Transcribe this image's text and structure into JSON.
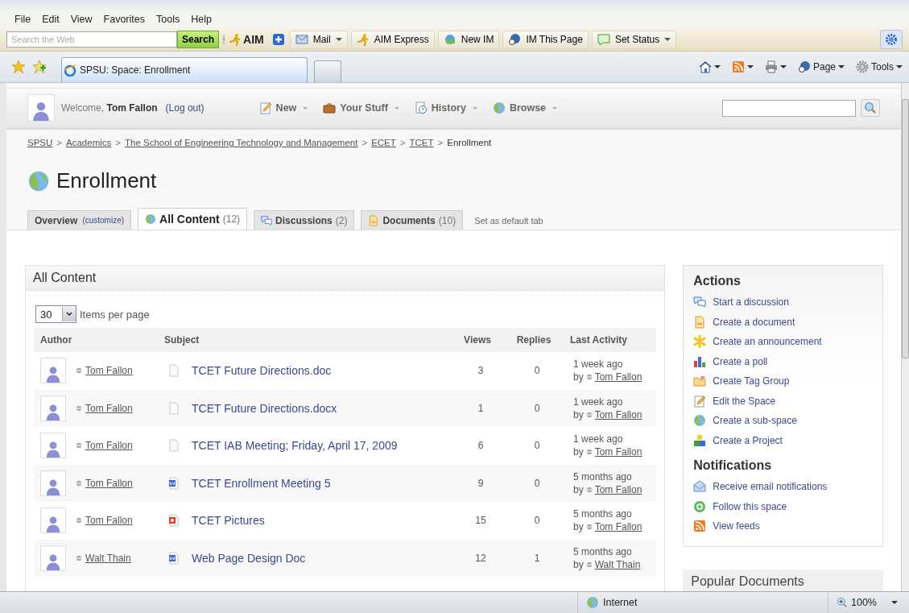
{
  "browser": {
    "menu": [
      "File",
      "Edit",
      "View",
      "Favorites",
      "Tools",
      "Help"
    ],
    "toolbar": {
      "search": {
        "placeholder": "Search the Web"
      },
      "search_button": "Search",
      "logo": "AIM",
      "buttons": [
        {
          "label": "Mail",
          "dropdown": true,
          "kind": "mail"
        },
        {
          "label": "AIM Express",
          "dropdown": false,
          "kind": "runner"
        },
        {
          "label": "New IM",
          "dropdown": false,
          "kind": "im"
        },
        {
          "label": "IM This Page",
          "dropdown": false,
          "kind": "page"
        },
        {
          "label": "Set Status",
          "dropdown": true,
          "kind": "status"
        }
      ]
    },
    "tabs": [
      {
        "label": "SPSU: Space: Enrollment",
        "selected": true
      }
    ],
    "commands": [
      {
        "kind": "home"
      },
      {
        "kind": "feeds"
      },
      {
        "kind": "print"
      },
      {
        "kind": "page",
        "label": "Page"
      },
      {
        "kind": "tools",
        "label": "Tools"
      }
    ],
    "status_bar": {
      "zone": "Internet",
      "zoom": "100%"
    }
  },
  "page": {
    "user": {
      "welcome": "Welcome,",
      "name": "Tom Fallon",
      "logout": "(Log out)"
    },
    "nav": [
      {
        "label": "New",
        "kind": "new"
      },
      {
        "label": "Your Stuff",
        "kind": "stuff"
      },
      {
        "label": "History",
        "kind": "history"
      },
      {
        "label": "Browse",
        "kind": "browse"
      }
    ],
    "breadcrumb": [
      {
        "label": "SPSU",
        "kind": "link"
      },
      {
        "label": ">",
        "kind": "separator"
      },
      {
        "label": "Academics",
        "kind": "link"
      },
      {
        "label": ">",
        "kind": "separator"
      },
      {
        "label": "The School of Engineering Technology and Management",
        "kind": "link"
      },
      {
        "label": ">",
        "kind": "separator"
      },
      {
        "label": "ECET",
        "kind": "link"
      },
      {
        "label": ">",
        "kind": "separator"
      },
      {
        "label": "TCET",
        "kind": "link"
      },
      {
        "label": ">",
        "kind": "separator"
      },
      {
        "label": "Enrollment",
        "kind": "current"
      }
    ],
    "title": "Enrollment",
    "tabs": [
      {
        "label": "Overview",
        "link": "(customize)",
        "selected": false,
        "kind": "none"
      },
      {
        "label": "All Content",
        "count": "(12)",
        "selected": true,
        "kind": "globe"
      },
      {
        "label": "Discussions",
        "count": "(2)",
        "selected": false,
        "kind": "discussion"
      },
      {
        "label": "Documents",
        "count": "(10)",
        "selected": false,
        "kind": "document"
      }
    ],
    "tab_hint": "Set as default tab",
    "content": {
      "title": "All Content",
      "per_page": {
        "value": "30",
        "label": "Items per page"
      },
      "columns": [
        "Author",
        "Subject",
        "Views",
        "Replies",
        "Last Activity"
      ],
      "rows": [
        {
          "author": "Tom Fallon",
          "kind": "blank",
          "subject": "TCET Future Directions.doc",
          "views": "3",
          "replies": "0",
          "when": "1 week ago",
          "by": "by",
          "by_author": "Tom Fallon"
        },
        {
          "author": "Tom Fallon",
          "kind": "blank",
          "subject": "TCET Future Directions.docx",
          "views": "1",
          "replies": "0",
          "when": "1 week ago",
          "by": "by",
          "by_author": "Tom Fallon"
        },
        {
          "author": "Tom Fallon",
          "kind": "blank",
          "subject": "TCET IAB Meeting; Friday, April 17, 2009",
          "views": "6",
          "replies": "0",
          "when": "1 week ago",
          "by": "by",
          "by_author": "Tom Fallon"
        },
        {
          "author": "Tom Fallon",
          "kind": "word",
          "subject": "TCET Enrollment Meeting 5",
          "views": "9",
          "replies": "0",
          "when": "5 months ago",
          "by": "by",
          "by_author": "Tom Fallon"
        },
        {
          "author": "Tom Fallon",
          "kind": "slides",
          "subject": "TCET Pictures",
          "views": "15",
          "replies": "0",
          "when": "5 months ago",
          "by": "by",
          "by_author": "Tom Fallon"
        },
        {
          "author": "Walt Thain",
          "kind": "word",
          "subject": "Web Page Design Doc",
          "views": "12",
          "replies": "1",
          "when": "5 months ago",
          "by": "by",
          "by_author": "Walt Thain"
        }
      ]
    },
    "sidebar": {
      "sections": [
        {
          "title": "Actions",
          "items": [
            {
              "label": "Start a discussion",
              "kind": "discussion"
            },
            {
              "label": "Create a document",
              "kind": "document"
            },
            {
              "label": "Create an announcement",
              "kind": "announcement"
            },
            {
              "label": "Create a poll",
              "kind": "poll"
            },
            {
              "label": "Create Tag Group",
              "kind": "tag"
            },
            {
              "label": "Edit the Space",
              "kind": "edit"
            },
            {
              "label": "Create a sub-space",
              "kind": "globe"
            },
            {
              "label": "Create a Project",
              "kind": "project"
            }
          ]
        },
        {
          "title": "Notifications",
          "items": [
            {
              "label": "Receive email notifications",
              "kind": "email"
            },
            {
              "label": "Follow this space",
              "kind": "follow"
            },
            {
              "label": "View feeds",
              "kind": "feed"
            }
          ]
        }
      ],
      "popular": {
        "title": "Popular Documents"
      }
    }
  }
}
